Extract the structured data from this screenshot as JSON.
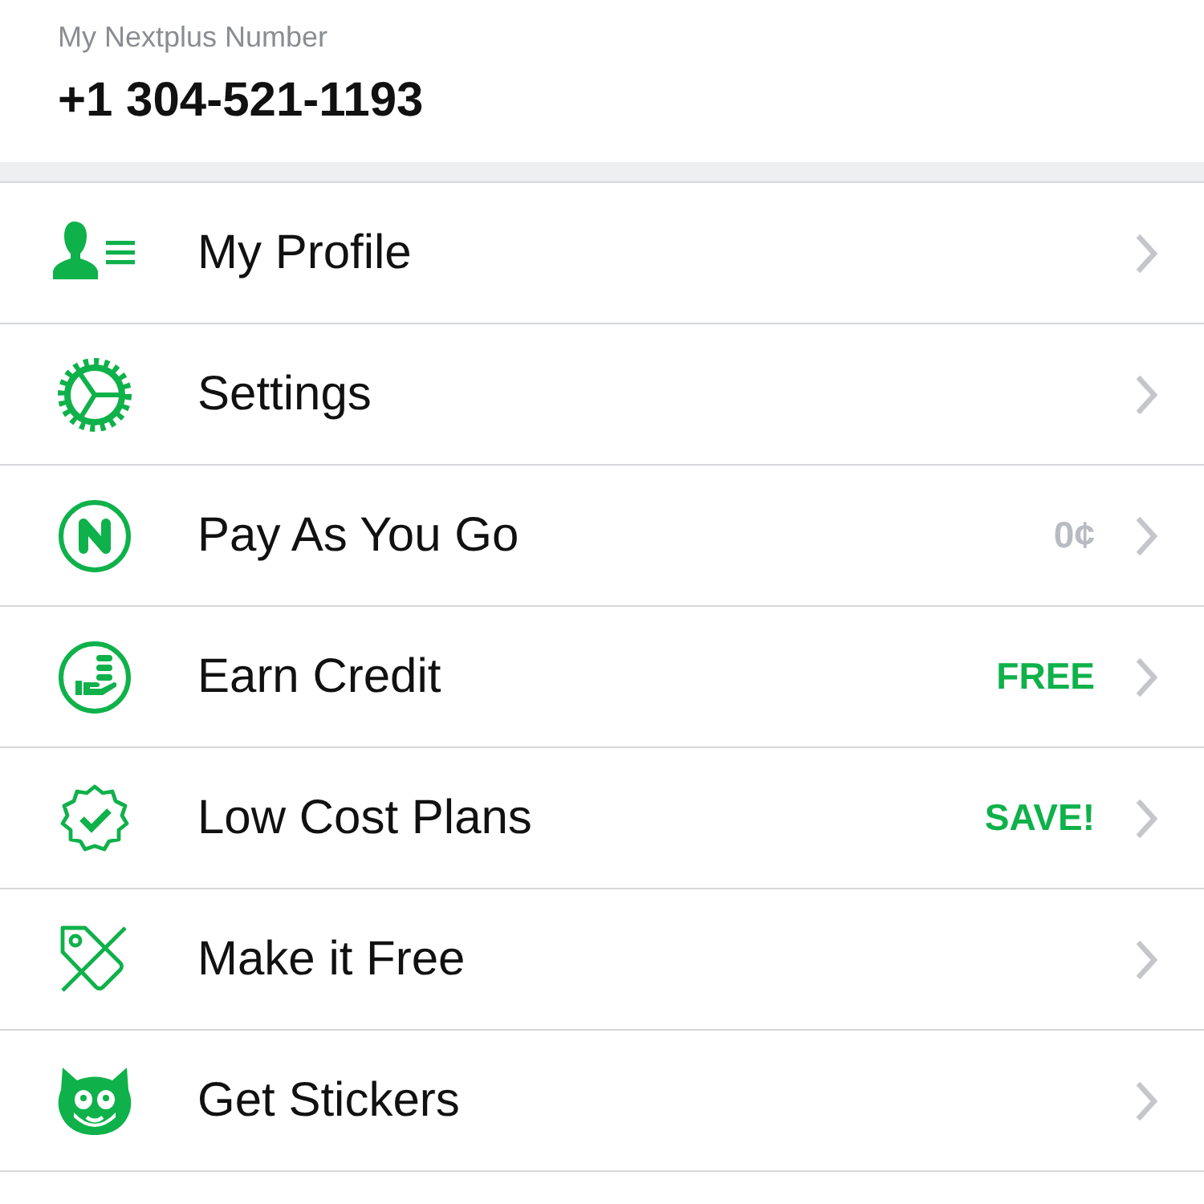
{
  "number_card": {
    "label": "My Nextplus Number",
    "number": "+1 304-521-1193"
  },
  "menu": [
    {
      "kind": "profile",
      "label": "My Profile"
    },
    {
      "kind": "settings",
      "label": "Settings"
    },
    {
      "kind": "payg",
      "label": "Pay As You Go",
      "badge": {
        "text": "0¢",
        "color": "#b8bcc2"
      }
    },
    {
      "kind": "credit",
      "label": "Earn Credit",
      "badge": {
        "text": "FREE",
        "color": "#0fb14a"
      }
    },
    {
      "kind": "plans",
      "label": "Low Cost Plans",
      "badge": {
        "text": "SAVE!",
        "color": "#0fb14a"
      }
    },
    {
      "kind": "free",
      "label": "Make it Free"
    },
    {
      "kind": "stickers",
      "label": "Get Stickers"
    }
  ]
}
